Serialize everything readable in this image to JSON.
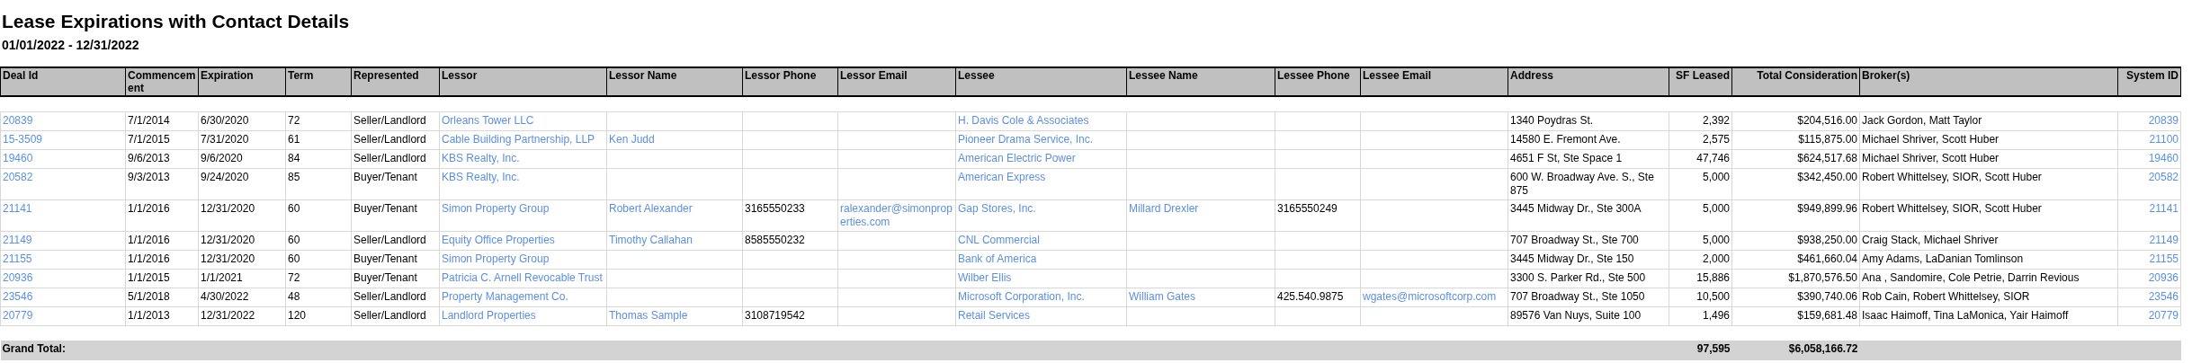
{
  "title": "Lease Expirations with Contact Details",
  "date_range": "01/01/2022 - 12/31/2022",
  "columns": [
    {
      "label": "Deal Id",
      "kind": "link"
    },
    {
      "label": "Commencement",
      "kind": "text"
    },
    {
      "label": "Expiration",
      "kind": "text"
    },
    {
      "label": "Term",
      "kind": "text"
    },
    {
      "label": "Represented",
      "kind": "text"
    },
    {
      "label": "Lessor",
      "kind": "link"
    },
    {
      "label": "Lessor Name",
      "kind": "link"
    },
    {
      "label": "Lessor Phone",
      "kind": "text"
    },
    {
      "label": "Lessor Email",
      "kind": "link"
    },
    {
      "label": "Lessee",
      "kind": "link"
    },
    {
      "label": "Lessee Name",
      "kind": "link"
    },
    {
      "label": "Lessee Phone",
      "kind": "text"
    },
    {
      "label": "Lessee Email",
      "kind": "link"
    },
    {
      "label": "Address",
      "kind": "text"
    },
    {
      "label": "SF Leased",
      "kind": "number"
    },
    {
      "label": "Total Consideration",
      "kind": "number"
    },
    {
      "label": "Broker(s)",
      "kind": "text"
    },
    {
      "label": "System ID",
      "kind": "link_number"
    }
  ],
  "rows": [
    {
      "deal_id": "20839",
      "commencement": "7/1/2014",
      "expiration": "6/30/2020",
      "term": "72",
      "represented": "Seller/Landlord",
      "lessor": "Orleans Tower LLC",
      "lessee": "H. Davis Cole & Associates",
      "address": "1340 Poydras St.",
      "sf_leased": "2,392",
      "total_consideration": "$204,516.00",
      "brokers": "Jack  Gordon, Matt Taylor",
      "system_id": "20839"
    },
    {
      "deal_id": "15-3509",
      "commencement": "7/1/2015",
      "expiration": "7/31/2020",
      "term": "61",
      "represented": "Seller/Landlord",
      "lessor": "Cable Building Partnership, LLP",
      "lessor_name": "Ken Judd",
      "lessee": "Pioneer Drama Service, Inc.",
      "address": "14580 E. Fremont Ave.",
      "sf_leased": "2,575",
      "total_consideration": "$115,875.00",
      "brokers": "Michael Shriver, Scott Huber",
      "system_id": "21100"
    },
    {
      "deal_id": "19460",
      "commencement": "9/6/2013",
      "expiration": "9/6/2020",
      "term": "84",
      "represented": "Seller/Landlord",
      "lessor": "KBS Realty, Inc.",
      "lessee": "American Electric Power",
      "address": "4651 F St, Ste Space 1",
      "sf_leased": "47,746",
      "total_consideration": "$624,517.68",
      "brokers": "Michael Shriver, Scott Huber",
      "system_id": "19460"
    },
    {
      "deal_id": "20582",
      "commencement": "9/3/2013",
      "expiration": "9/24/2020",
      "term": "85",
      "represented": "Buyer/Tenant",
      "lessor": "KBS Realty, Inc.",
      "lessee": "American Express",
      "address": "600 W. Broadway Ave. S., Ste 875",
      "sf_leased": "5,000",
      "total_consideration": "$342,450.00",
      "brokers": "Robert Whittelsey, SIOR, Scott Huber",
      "system_id": "20582"
    },
    {
      "deal_id": "21141",
      "commencement": "1/1/2016",
      "expiration": "12/31/2020",
      "term": "60",
      "represented": "Buyer/Tenant",
      "lessor": "Simon Property Group",
      "lessor_name": "Robert Alexander",
      "lessor_phone": "3165550233",
      "lessor_email": "ralexander@simonproperties.com",
      "lessee": "Gap Stores, Inc.",
      "lessee_name": "Millard Drexler",
      "lessee_phone": "3165550249",
      "address": "3445 Midway Dr., Ste 300A",
      "sf_leased": "5,000",
      "total_consideration": "$949,899.96",
      "brokers": "Robert Whittelsey, SIOR, Scott Huber",
      "system_id": "21141"
    },
    {
      "deal_id": "21149",
      "commencement": "1/1/2016",
      "expiration": "12/31/2020",
      "term": "60",
      "represented": "Seller/Landlord",
      "lessor": "Equity Office Properties",
      "lessor_name": "Timothy Callahan",
      "lessor_phone": "8585550232",
      "lessee": "CNL Commercial",
      "address": "707 Broadway St., Ste 700",
      "sf_leased": "5,000",
      "total_consideration": "$938,250.00",
      "brokers": "Craig Stack, Michael Shriver",
      "system_id": "21149"
    },
    {
      "deal_id": "21155",
      "commencement": "1/1/2016",
      "expiration": "12/31/2020",
      "term": "60",
      "represented": "Buyer/Tenant",
      "lessor": "Simon Property Group",
      "lessee": "Bank of America",
      "address": "3445 Midway Dr., Ste 150",
      "sf_leased": "2,000",
      "total_consideration": "$461,660.04",
      "brokers": "Amy Adams, LaDanian Tomlinson",
      "system_id": "21155"
    },
    {
      "deal_id": "20936",
      "commencement": "1/1/2015",
      "expiration": "1/1/2021",
      "term": "72",
      "represented": "Buyer/Tenant",
      "lessor": "Patricia C. Arnell Revocable Trust",
      "lessee": "Wilber Ellis",
      "address": "3300 S. Parker Rd., Ste 500",
      "sf_leased": "15,886",
      "total_consideration": "$1,870,576.50",
      "brokers": "Ana ,  Sandomire, Cole Petrie, Darrin Revious",
      "system_id": "20936"
    },
    {
      "deal_id": "23546",
      "commencement": "5/1/2018",
      "expiration": "4/30/2022",
      "term": "48",
      "represented": "Seller/Landlord",
      "lessor": "Property Management Co.",
      "lessee": "Microsoft Corporation, Inc.",
      "lessee_name": "William Gates",
      "lessee_phone": "425.540.9875",
      "lessee_email": "wgates@microsoftcorp.com",
      "address": "707 Broadway St., Ste 1050",
      "sf_leased": "10,500",
      "total_consideration": "$390,740.06",
      "brokers": "Rob Cain, Robert Whittelsey, SIOR",
      "system_id": "23546"
    },
    {
      "deal_id": "20779",
      "commencement": "1/1/2013",
      "expiration": "12/31/2022",
      "term": "120",
      "represented": "Seller/Landlord",
      "lessor": "Landlord Properties",
      "lessor_name": "Thomas Sample",
      "lessor_phone": "3108719542",
      "lessee": "Retail Services",
      "address": "89576 Van Nuys, Suite 100",
      "sf_leased": "1,496",
      "total_consideration": "$159,681.48",
      "brokers": "Isaac Haimoff, Tina LaMonica, Yair Haimoff",
      "system_id": "20779"
    }
  ],
  "grand_total": {
    "label": "Grand Total:",
    "sf_leased": "97,595",
    "total_consideration": "$6,058,166.72"
  }
}
